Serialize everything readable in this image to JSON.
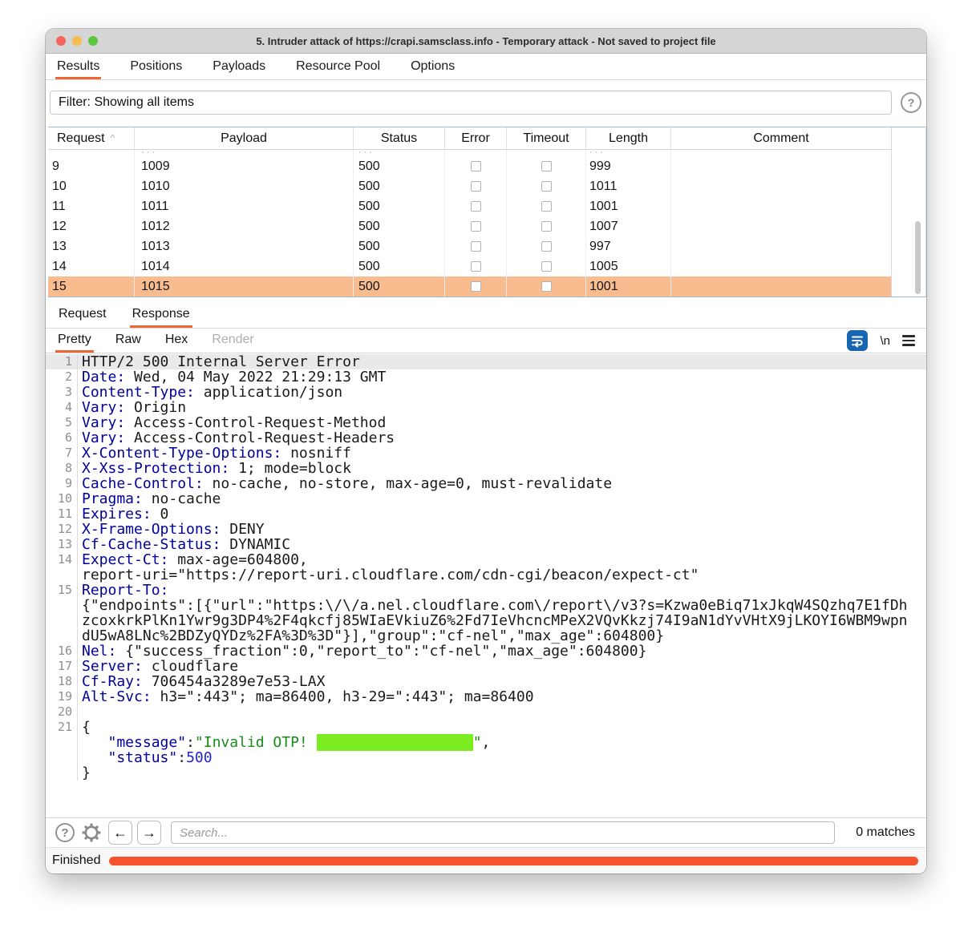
{
  "colors": {
    "accent": "#ee6633",
    "selected_row": "#f8bc8e",
    "highlight": "#7bed21",
    "progress": "#f4532c",
    "header_name": "#00009b",
    "string_green": "#188a18",
    "number_blue": "#2424d6",
    "wrap_button": "#1666b2"
  },
  "window": {
    "title": "5. Intruder attack of https://crapi.samsclass.info - Temporary attack - Not saved to project file"
  },
  "menu_tabs": [
    {
      "label": "Results"
    },
    {
      "label": "Positions"
    },
    {
      "label": "Payloads"
    },
    {
      "label": "Resource Pool"
    },
    {
      "label": "Options"
    }
  ],
  "filter": {
    "text": "Filter: Showing all items",
    "help_icon": "?"
  },
  "results_table": {
    "columns": [
      "Request",
      "Payload",
      "Status",
      "Error",
      "Timeout",
      "Length",
      "Comment"
    ],
    "sort_indicator": "^",
    "partial_row_hint": "···",
    "rows": [
      {
        "request": "9",
        "payload": "1009",
        "status": "500",
        "length": "999",
        "comment": "",
        "selected": false
      },
      {
        "request": "10",
        "payload": "1010",
        "status": "500",
        "length": "1011",
        "comment": "",
        "selected": false
      },
      {
        "request": "11",
        "payload": "1011",
        "status": "500",
        "length": "1001",
        "comment": "",
        "selected": false
      },
      {
        "request": "12",
        "payload": "1012",
        "status": "500",
        "length": "1007",
        "comment": "",
        "selected": false
      },
      {
        "request": "13",
        "payload": "1013",
        "status": "500",
        "length": "997",
        "comment": "",
        "selected": false
      },
      {
        "request": "14",
        "payload": "1014",
        "status": "500",
        "length": "1005",
        "comment": "",
        "selected": false
      },
      {
        "request": "15",
        "payload": "1015",
        "status": "500",
        "length": "1001",
        "comment": "",
        "selected": true
      }
    ]
  },
  "viewer": {
    "tabs": [
      {
        "label": "Request"
      },
      {
        "label": "Response"
      }
    ],
    "subtabs": [
      {
        "label": "Pretty"
      },
      {
        "label": "Raw"
      },
      {
        "label": "Hex"
      },
      {
        "label": "Render"
      }
    ],
    "newline_label": "\\n"
  },
  "response_editor": {
    "lines": [
      {
        "n": "1",
        "hl": true,
        "parts": [
          {
            "c": "plain",
            "t": "HTTP/2 500 Internal Server Error"
          }
        ]
      },
      {
        "n": "2",
        "parts": [
          {
            "c": "name",
            "t": "Date:"
          },
          {
            "c": "plain",
            "t": " Wed, 04 May 2022 21:29:13 GMT"
          }
        ]
      },
      {
        "n": "3",
        "parts": [
          {
            "c": "name",
            "t": "Content-Type:"
          },
          {
            "c": "plain",
            "t": " application/json"
          }
        ]
      },
      {
        "n": "4",
        "parts": [
          {
            "c": "name",
            "t": "Vary:"
          },
          {
            "c": "plain",
            "t": " Origin"
          }
        ]
      },
      {
        "n": "5",
        "parts": [
          {
            "c": "name",
            "t": "Vary:"
          },
          {
            "c": "plain",
            "t": " Access-Control-Request-Method"
          }
        ]
      },
      {
        "n": "6",
        "parts": [
          {
            "c": "name",
            "t": "Vary:"
          },
          {
            "c": "plain",
            "t": " Access-Control-Request-Headers"
          }
        ]
      },
      {
        "n": "7",
        "parts": [
          {
            "c": "name",
            "t": "X-Content-Type-Options:"
          },
          {
            "c": "plain",
            "t": " nosniff"
          }
        ]
      },
      {
        "n": "8",
        "parts": [
          {
            "c": "name",
            "t": "X-Xss-Protection:"
          },
          {
            "c": "plain",
            "t": " 1; mode=block"
          }
        ]
      },
      {
        "n": "9",
        "parts": [
          {
            "c": "name",
            "t": "Cache-Control:"
          },
          {
            "c": "plain",
            "t": " no-cache, no-store, max-age=0, must-revalidate"
          }
        ]
      },
      {
        "n": "10",
        "parts": [
          {
            "c": "name",
            "t": "Pragma:"
          },
          {
            "c": "plain",
            "t": " no-cache"
          }
        ]
      },
      {
        "n": "11",
        "parts": [
          {
            "c": "name",
            "t": "Expires:"
          },
          {
            "c": "plain",
            "t": " 0"
          }
        ]
      },
      {
        "n": "12",
        "parts": [
          {
            "c": "name",
            "t": "X-Frame-Options:"
          },
          {
            "c": "plain",
            "t": " DENY"
          }
        ]
      },
      {
        "n": "13",
        "parts": [
          {
            "c": "name",
            "t": "Cf-Cache-Status:"
          },
          {
            "c": "plain",
            "t": " DYNAMIC"
          }
        ]
      },
      {
        "n": "14",
        "parts": [
          {
            "c": "name",
            "t": "Expect-Ct:"
          },
          {
            "c": "plain",
            "t": " max-age=604800,"
          }
        ]
      },
      {
        "n": "",
        "parts": [
          {
            "c": "plain",
            "t": "report-uri=\"https://report-uri.cloudflare.com/cdn-cgi/beacon/expect-ct\""
          }
        ]
      },
      {
        "n": "15",
        "parts": [
          {
            "c": "name",
            "t": "Report-To:"
          }
        ]
      },
      {
        "n": "",
        "parts": [
          {
            "c": "plain",
            "t": "{\"endpoints\":[{\"url\":\"https:\\/\\/a.nel.cloudflare.com\\/report\\/v3?s=Kzwa0eBiq71xJkqW4SQzhq7E1fDh"
          }
        ]
      },
      {
        "n": "",
        "parts": [
          {
            "c": "plain",
            "t": "zcoxkrkPlKn1Ywr9g3DP4%2F4qkcfj85WIaEVkiuZ6%2Fd7IeVhcncMPeX2VQvKkzj74I9aN1dYvVHtX9jLKOYI6WBM9wpn"
          }
        ]
      },
      {
        "n": "",
        "parts": [
          {
            "c": "plain",
            "t": "dU5wA8LNc%2BDZyQYDz%2FA%3D%3D\"}],\"group\":\"cf-nel\",\"max_age\":604800}"
          }
        ]
      },
      {
        "n": "16",
        "parts": [
          {
            "c": "name",
            "t": "Nel:"
          },
          {
            "c": "plain",
            "t": " {\"success_fraction\":0,\"report_to\":\"cf-nel\",\"max_age\":604800}"
          }
        ]
      },
      {
        "n": "17",
        "parts": [
          {
            "c": "name",
            "t": "Server:"
          },
          {
            "c": "plain",
            "t": " cloudflare"
          }
        ]
      },
      {
        "n": "18",
        "parts": [
          {
            "c": "name",
            "t": "Cf-Ray:"
          },
          {
            "c": "plain",
            "t": " 706454a3289e7e53-LAX"
          }
        ]
      },
      {
        "n": "19",
        "parts": [
          {
            "c": "name",
            "t": "Alt-Svc:"
          },
          {
            "c": "plain",
            "t": " h3=\":443\"; ma=86400, h3-29=\":443\"; ma=86400"
          }
        ]
      },
      {
        "n": "20",
        "parts": []
      },
      {
        "n": "21",
        "parts": [
          {
            "c": "plain",
            "t": "{"
          }
        ]
      },
      {
        "n": "",
        "parts": [
          {
            "c": "name",
            "t": "   \"message\""
          },
          {
            "c": "plain",
            "t": ":"
          },
          {
            "c": "str",
            "t": "\"Invalid OTP! "
          },
          {
            "c": "mark",
            "t": "                  "
          },
          {
            "c": "str",
            "t": "\""
          },
          {
            "c": "plain",
            "t": ","
          }
        ]
      },
      {
        "n": "",
        "parts": [
          {
            "c": "name",
            "t": "   \"status\""
          },
          {
            "c": "plain",
            "t": ":"
          },
          {
            "c": "num",
            "t": "500"
          }
        ]
      },
      {
        "n": "",
        "parts": [
          {
            "c": "plain",
            "t": "}"
          }
        ]
      }
    ]
  },
  "find_bar": {
    "placeholder": "Search...",
    "matches": "0 matches"
  },
  "status_bar": {
    "label": "Finished"
  }
}
